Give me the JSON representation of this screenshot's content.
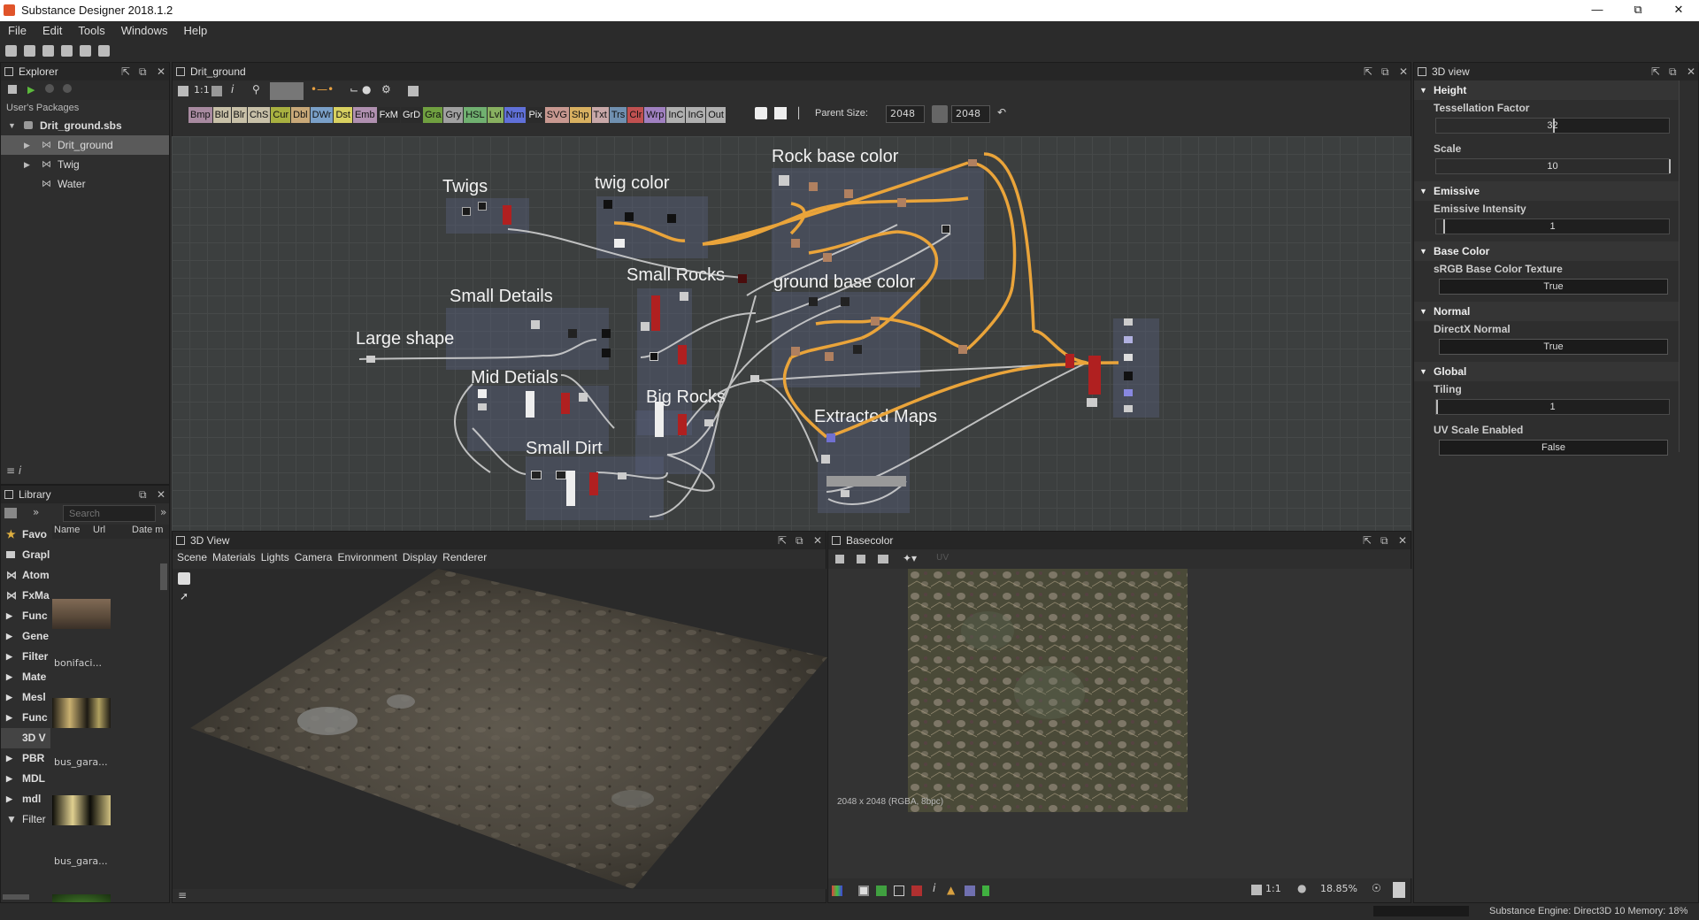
{
  "window": {
    "title": "Substance Designer 2018.1.2"
  },
  "menu": [
    "File",
    "Edit",
    "Tools",
    "Windows",
    "Help"
  ],
  "explorer": {
    "title": "Explorer",
    "section": "User's Packages",
    "package": "Drit_ground.sbs",
    "items": [
      "Drit_ground",
      "Twig",
      "Water"
    ]
  },
  "library": {
    "title": "Library",
    "search_placeholder": "Search",
    "columns": [
      "Name",
      "Url",
      "Date m"
    ],
    "categories": [
      "Favo",
      "Grapl",
      "Atom",
      "FxMa",
      "Func",
      "Gene",
      "Filter",
      "Mate",
      "Mesl",
      "Func",
      "3D V",
      "PBR",
      "MDL",
      "mdl",
      "Filter"
    ],
    "thumbs": [
      "bonifaci...",
      "bus_gara...",
      "bus_gara..."
    ]
  },
  "graph": {
    "title": "Drit_ground",
    "zoom_label": "1:1",
    "parent_size_label": "Parent Size:",
    "parent_size": "2048",
    "size2": "2048",
    "chips": [
      {
        "t": "Bmp",
        "c": "#a88aa0"
      },
      {
        "t": "Bld",
        "c": "#c8c0a8"
      },
      {
        "t": "Blr",
        "c": "#c8c0a8"
      },
      {
        "t": "ChS",
        "c": "#c8c0a8"
      },
      {
        "t": "Cur",
        "c": "#a8b040"
      },
      {
        "t": "Dbl",
        "c": "#c8a878"
      },
      {
        "t": "DWr",
        "c": "#7aa0c8"
      },
      {
        "t": "Dst",
        "c": "#d8d060"
      },
      {
        "t": "Emb",
        "c": "#b090b0"
      },
      {
        "t": "FxM",
        "c": "#2b2b2b"
      },
      {
        "t": "GrD",
        "c": "#2b2b2b"
      },
      {
        "t": "Gra",
        "c": "#70a040"
      },
      {
        "t": "Gry",
        "c": "#a0a0a0"
      },
      {
        "t": "HSL",
        "c": "#70b070"
      },
      {
        "t": "Lvl",
        "c": "#88b060"
      },
      {
        "t": "Nrm",
        "c": "#6070d8"
      },
      {
        "t": "Pix",
        "c": "#2b2b2b"
      },
      {
        "t": "SVG",
        "c": "#c89890"
      },
      {
        "t": "Shp",
        "c": "#d8b060"
      },
      {
        "t": "Txt",
        "c": "#c8a8a8"
      },
      {
        "t": "Trs",
        "c": "#7090b0"
      },
      {
        "t": "Clr",
        "c": "#c05050"
      },
      {
        "t": "Wrp",
        "c": "#a080c0"
      },
      {
        "t": "InC",
        "c": "#b0b0b0"
      },
      {
        "t": "InG",
        "c": "#b0b0b0"
      },
      {
        "t": "Out",
        "c": "#b0b0b0"
      }
    ],
    "frames": [
      "Twigs",
      "twig color",
      "Rock base color",
      "Small Details",
      "Small Rocks",
      "ground base color",
      "Large shape",
      "Mid Detials",
      "Big Rocks",
      "Extracted Maps",
      "Small Dirt"
    ]
  },
  "props": {
    "title": "3D view",
    "sections": [
      {
        "name": "Height",
        "fields": [
          {
            "label": "Tessellation Factor",
            "value": "32",
            "kind": "slider",
            "fill": 0.5
          },
          {
            "label": "Scale",
            "value": "10",
            "kind": "slider",
            "fill": 1.0
          }
        ]
      },
      {
        "name": "Emissive",
        "fields": [
          {
            "label": "Emissive Intensity",
            "value": "1",
            "kind": "slider",
            "fill": 0.03
          }
        ]
      },
      {
        "name": "Base Color",
        "fields": [
          {
            "label": "sRGB Base Color Texture",
            "value": "True",
            "kind": "button"
          }
        ]
      },
      {
        "name": "Normal",
        "fields": [
          {
            "label": "DirectX Normal",
            "value": "True",
            "kind": "button"
          }
        ]
      },
      {
        "name": "Global",
        "fields": [
          {
            "label": "Tiling",
            "value": "1",
            "kind": "slider",
            "fill": 0.0
          },
          {
            "label": "UV Scale Enabled",
            "value": "False",
            "kind": "button"
          }
        ]
      }
    ]
  },
  "view3d": {
    "title": "3D View",
    "menu": [
      "Scene",
      "Materials",
      "Lights",
      "Camera",
      "Environment",
      "Display",
      "Renderer"
    ]
  },
  "view2d": {
    "title": "Basecolor",
    "uv_label": "UV",
    "info": "2048 x 2048 (RGBA, 8bpc)",
    "ratio": "1:1",
    "zoom": "18.85%"
  },
  "status": "Substance Engine: Direct3D 10  Memory: 18%"
}
